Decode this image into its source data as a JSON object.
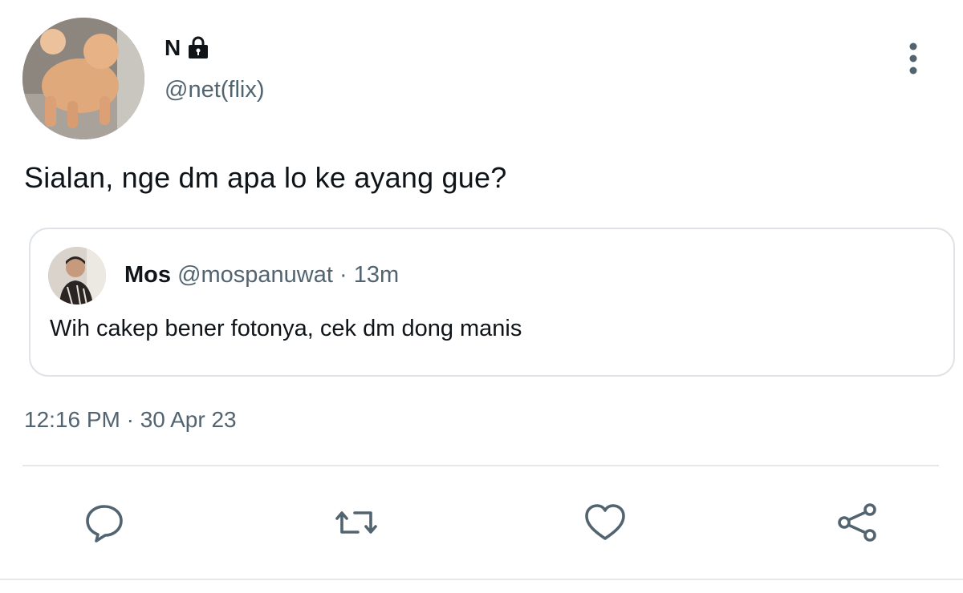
{
  "tweet": {
    "author": {
      "display_name": "N",
      "handle": "@net(flix)",
      "avatar_icon": "dog-photo-avatar",
      "protected_icon": "lock-icon"
    },
    "text": "Sialan, nge dm apa lo ke ayang gue?",
    "timestamp": "12:16 PM · 30 Apr 23",
    "quoted": {
      "display_name": "Mos",
      "handle": "@mospanuwat",
      "separator": "·",
      "time_ago": "13m",
      "text": "Wih cakep bener fotonya, cek dm dong manis",
      "avatar_icon": "person-photo-avatar"
    }
  },
  "actions": [
    {
      "name": "reply",
      "icon": "comment-icon"
    },
    {
      "name": "retweet",
      "icon": "retweet-icon"
    },
    {
      "name": "like",
      "icon": "heart-icon"
    },
    {
      "name": "share",
      "icon": "share-icon"
    }
  ],
  "colors": {
    "text_primary": "#0f1419",
    "text_secondary": "#536471",
    "icon_gray": "#536471",
    "border": "#dfe3e7"
  }
}
